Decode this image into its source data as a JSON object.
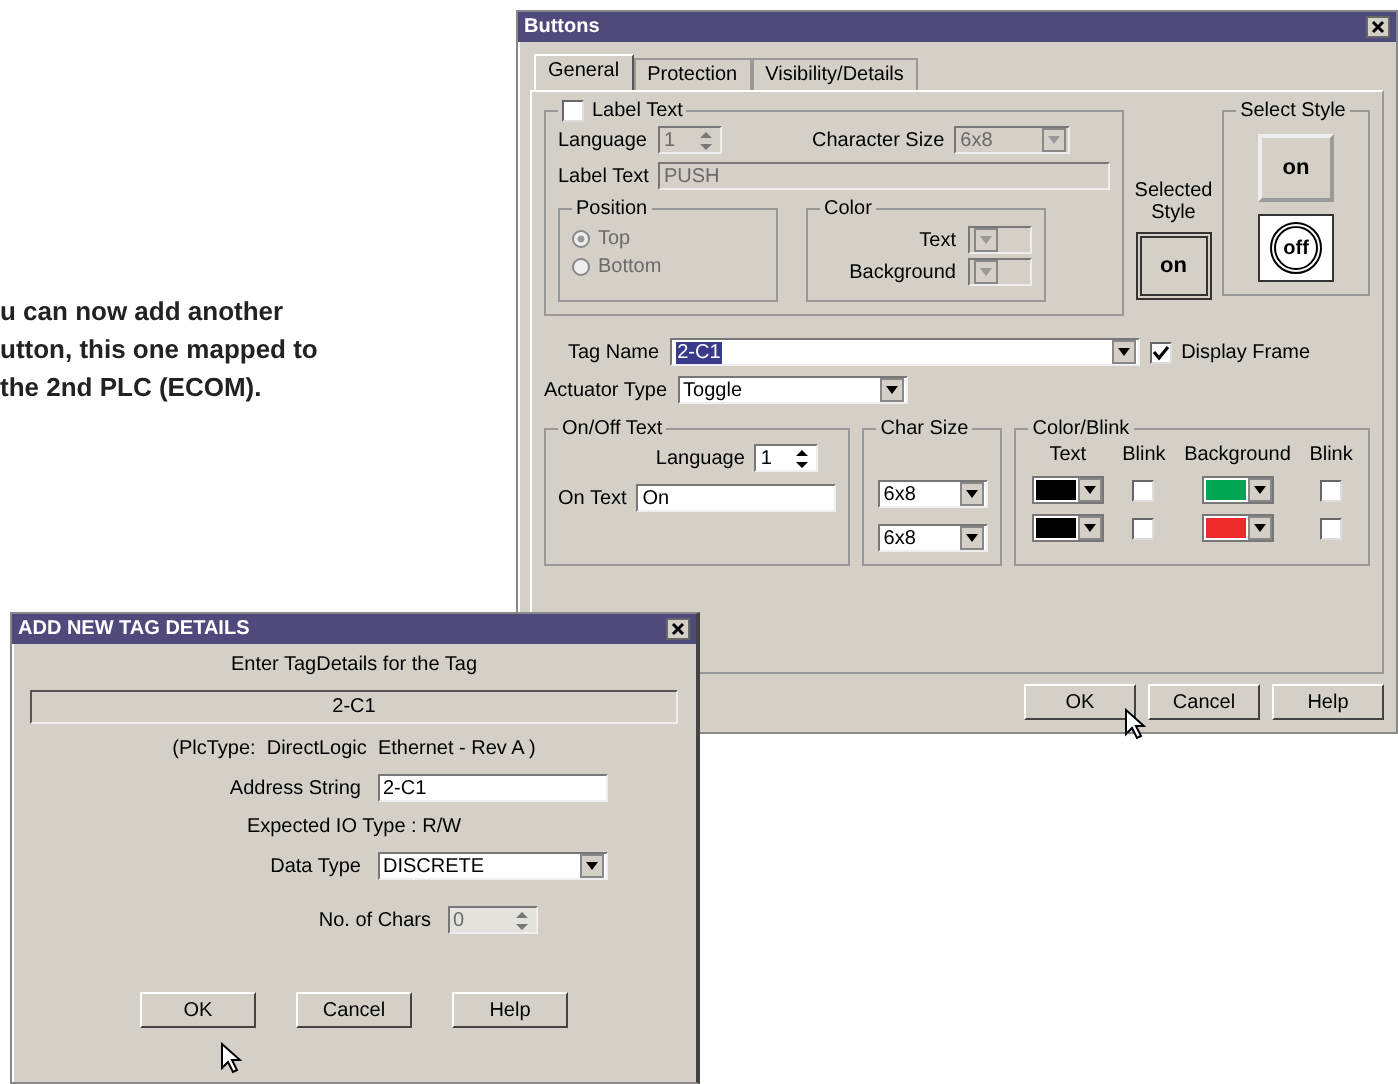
{
  "caption": [
    "u can now add another",
    "utton, this one mapped to",
    "the 2nd PLC (ECOM)."
  ],
  "buttons_dialog": {
    "title": "Buttons",
    "tabs": [
      {
        "label": "General",
        "selected": true
      },
      {
        "label": "Protection",
        "selected": false
      },
      {
        "label": "Visibility/Details",
        "selected": false
      }
    ],
    "label_text": {
      "label": "Label Text",
      "checked": false,
      "language_label": "Language",
      "language": "1",
      "character_size_label": "Character Size",
      "character_size": "6x8",
      "label_text_label": "Label Text",
      "label_text": "PUSH",
      "position": {
        "title": "Position",
        "options": [
          {
            "label": "Top",
            "selected": true
          },
          {
            "label": "Bottom",
            "selected": false
          }
        ]
      },
      "color": {
        "title": "Color",
        "text_label": "Text",
        "background_label": "Background"
      }
    },
    "selected_style": {
      "label": "Selected Style",
      "button": "on"
    },
    "select_style": {
      "title": "Select Style",
      "options": [
        {
          "kind": "square",
          "label": "on"
        },
        {
          "kind": "round",
          "label": "off"
        }
      ]
    },
    "tag_name": {
      "label": "Tag Name",
      "value": "2-C1",
      "highlighted": true
    },
    "display_frame": {
      "label": "Display Frame",
      "checked": true
    },
    "actuator_type": {
      "label": "Actuator Type",
      "value": "Toggle"
    },
    "on_off_text": {
      "title": "On/Off Text",
      "language_label": "Language",
      "language": "1",
      "on_text_label": "On Text",
      "on_text": "On"
    },
    "char_size": {
      "title": "Char Size",
      "values": [
        "6x8",
        "6x8"
      ]
    },
    "color_blink": {
      "title": "Color/Blink",
      "headers": [
        "Text",
        "Blink",
        "Background",
        "Blink"
      ],
      "rows": [
        {
          "text": {
            "color": "#000000",
            "blink": false
          },
          "background": {
            "color": "#00a651",
            "blink": false
          }
        },
        {
          "text": {
            "color": "#000000",
            "blink": false
          },
          "background": {
            "color": "#ee2a2a",
            "blink": false
          }
        }
      ]
    },
    "buttons": [
      "OK",
      "Cancel",
      "Help"
    ]
  },
  "tag_dialog": {
    "title": "ADD NEW TAG DETAILS",
    "prompt": "Enter TagDetails for the Tag",
    "tag": "2-C1",
    "plc_type": "(PlcType:  DirectLogic  Ethernet - Rev A )",
    "address_label": "Address String",
    "address": "2-C1",
    "expected": "Expected IO Type : R/W",
    "data_type_label": "Data Type",
    "data_type": "DISCRETE",
    "chars_label": "No. of Chars",
    "chars": "0",
    "chars_disabled": true,
    "buttons": [
      "OK",
      "Cancel",
      "Help"
    ]
  }
}
